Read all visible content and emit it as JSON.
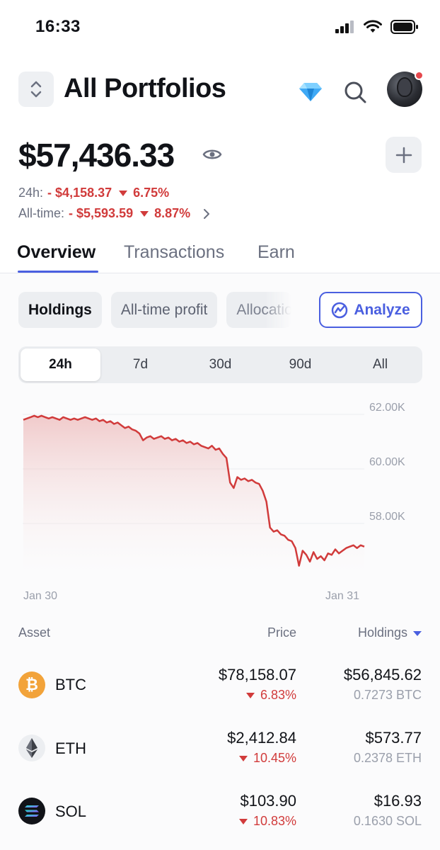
{
  "status_bar": {
    "time": "16:33"
  },
  "header": {
    "title": "All Portfolios"
  },
  "balance": {
    "amount": "$57,436.33",
    "change_24h_label": "24h:",
    "change_24h_value": "- $4,158.37",
    "change_24h_pct": "6.75%",
    "change_alltime_label": "All-time:",
    "change_alltime_value": "- $5,593.59",
    "change_alltime_pct": "8.87%"
  },
  "tabs": [
    {
      "label": "Overview",
      "active": true
    },
    {
      "label": "Transactions",
      "active": false
    },
    {
      "label": "Earn",
      "active": false
    }
  ],
  "chips": [
    {
      "label": "Holdings",
      "active": true
    },
    {
      "label": "All-time profit",
      "active": false
    },
    {
      "label": "Allocation",
      "active": false
    }
  ],
  "analyze_label": "Analyze",
  "ranges": [
    {
      "label": "24h",
      "active": true
    },
    {
      "label": "7d",
      "active": false
    },
    {
      "label": "30d",
      "active": false
    },
    {
      "label": "90d",
      "active": false
    },
    {
      "label": "All",
      "active": false
    }
  ],
  "chart": {
    "y_ticks": [
      "62.00K",
      "60.00K",
      "58.00K"
    ],
    "x_labels": [
      "Jan 30",
      "Jan 31"
    ],
    "line_color": "#d13b3b"
  },
  "chart_data": {
    "type": "area",
    "x_labels": [
      "Jan 30",
      "Jan 31"
    ],
    "y_ticks": [
      62000,
      60000,
      58000
    ],
    "ylim": [
      56000,
      62300
    ],
    "values": [
      61800,
      61850,
      61900,
      61950,
      61900,
      61950,
      61900,
      61850,
      61900,
      61850,
      61800,
      61900,
      61850,
      61800,
      61850,
      61800,
      61850,
      61900,
      61850,
      61800,
      61850,
      61750,
      61800,
      61700,
      61750,
      61650,
      61700,
      61600,
      61500,
      61550,
      61450,
      61400,
      61300,
      61050,
      61150,
      61200,
      61100,
      61150,
      61200,
      61100,
      61150,
      61050,
      61100,
      61000,
      61050,
      60950,
      61000,
      60900,
      60950,
      60850,
      60800,
      60750,
      60850,
      60700,
      60750,
      60550,
      60400,
      59500,
      59300,
      59700,
      59600,
      59650,
      59550,
      59600,
      59500,
      59450,
      59200,
      58800,
      57850,
      57700,
      57750,
      57600,
      57550,
      57400,
      57350,
      57100,
      56450,
      57000,
      56850,
      56600,
      56950,
      56700,
      56800,
      56650,
      56900,
      56850,
      57050,
      56900,
      57000,
      57100,
      57150,
      57200,
      57100,
      57200,
      57150
    ]
  },
  "table": {
    "col_asset": "Asset",
    "col_price": "Price",
    "col_holdings": "Holdings",
    "rows": [
      {
        "symbol": "BTC",
        "price": "$78,158.07",
        "pct": "6.83%",
        "value": "$56,845.62",
        "qty": "0.7273 BTC",
        "color": "#f2a33a"
      },
      {
        "symbol": "ETH",
        "price": "$2,412.84",
        "pct": "10.45%",
        "value": "$573.77",
        "qty": "0.2378 ETH",
        "color": "#eceef1"
      },
      {
        "symbol": "SOL",
        "price": "$103.90",
        "pct": "10.83%",
        "value": "$16.93",
        "qty": "0.1630 SOL",
        "color": "#111318"
      }
    ]
  }
}
